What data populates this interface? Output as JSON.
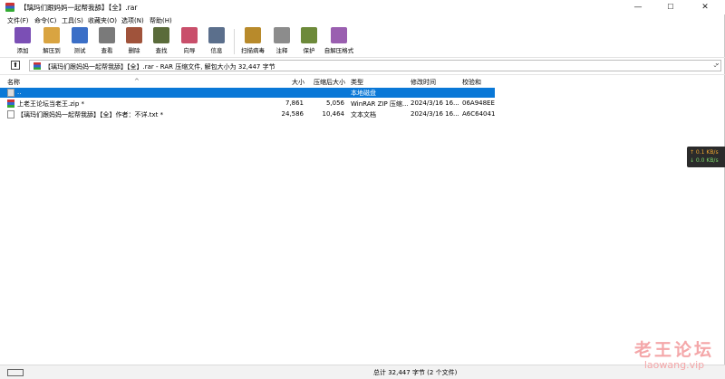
{
  "window": {
    "title": "【璃玛们跟妈妈一起帮我舔】【全】.rar"
  },
  "window_controls": {
    "minimize": "—",
    "maximize": "☐",
    "close": "✕"
  },
  "menu": [
    "文件(F)",
    "命令(C)",
    "工具(S)",
    "收藏夹(O)",
    "选项(N)",
    "帮助(H)"
  ],
  "toolbar": [
    {
      "label": "添加",
      "icon": "add-icon",
      "color": "#7b4fb5"
    },
    {
      "label": "解压到",
      "icon": "extract-icon",
      "color": "#d9a441"
    },
    {
      "label": "测试",
      "icon": "test-icon",
      "color": "#3b6fc7"
    },
    {
      "label": "查看",
      "icon": "view-icon",
      "color": "#7a7a7a"
    },
    {
      "label": "删除",
      "icon": "delete-icon",
      "color": "#a0533b"
    },
    {
      "label": "查找",
      "icon": "find-icon",
      "color": "#5a6b3a"
    },
    {
      "label": "向导",
      "icon": "wizard-icon",
      "color": "#c94f6b"
    },
    {
      "label": "信息",
      "icon": "info-icon",
      "color": "#5b6f8c"
    },
    {
      "label": "扫描病毒",
      "icon": "scan-icon",
      "color": "#b88a2b"
    },
    {
      "label": "注释",
      "icon": "comment-icon",
      "color": "#8c8c8c"
    },
    {
      "label": "保护",
      "icon": "protect-icon",
      "color": "#6d8a3a"
    },
    {
      "label": "自解压格式",
      "icon": "sfx-icon",
      "color": "#9a5fb0"
    }
  ],
  "address": {
    "text": "【璃玛们跟妈妈一起帮我舔】【全】.rar - RAR 压缩文件, 解包大小为 32,447 字节"
  },
  "columns": [
    "名称",
    "大小",
    "压缩后大小",
    "类型",
    "修改时间",
    "校验和"
  ],
  "rows": [
    {
      "name": "..",
      "size": "",
      "packed": "",
      "type": "本地磁盘",
      "modified": "",
      "crc": "",
      "selected": true
    },
    {
      "name": "上老王论坛当老王.zip *",
      "size": "7,861",
      "packed": "5,056",
      "type": "WinRAR ZIP 压缩...",
      "modified": "2024/3/16 16...",
      "crc": "06A948EE",
      "selected": false
    },
    {
      "name": "【璃玛们跟妈妈一起帮我舔】【全】作者：不详.txt *",
      "size": "24,586",
      "packed": "10,464",
      "type": "文本文档",
      "modified": "2024/3/16 16...",
      "crc": "A6C64041",
      "selected": false
    }
  ],
  "status": {
    "text": "总计 32,447 字节 (2 个文件)"
  },
  "speed": {
    "up": "↑ 0.1 KB/s",
    "down": "↓ 0.0 KB/s"
  },
  "watermark": {
    "cn": "老王论坛",
    "en": "laowang.vip"
  }
}
